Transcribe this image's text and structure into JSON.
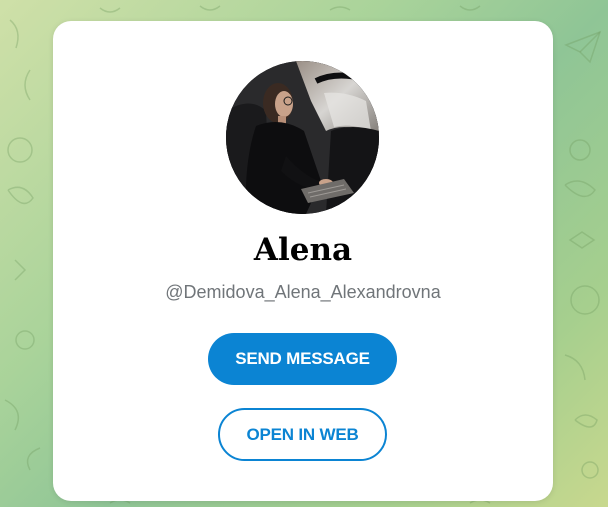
{
  "profile": {
    "name": "Alena",
    "username": "@Demidova_Alena_Alexandrovna",
    "avatar_icon": "profile-photo"
  },
  "actions": {
    "send_message_label": "SEND MESSAGE",
    "open_in_web_label": "OPEN IN WEB"
  },
  "colors": {
    "accent": "#0b84d3",
    "muted_text": "#707579",
    "card_background": "#ffffff"
  }
}
